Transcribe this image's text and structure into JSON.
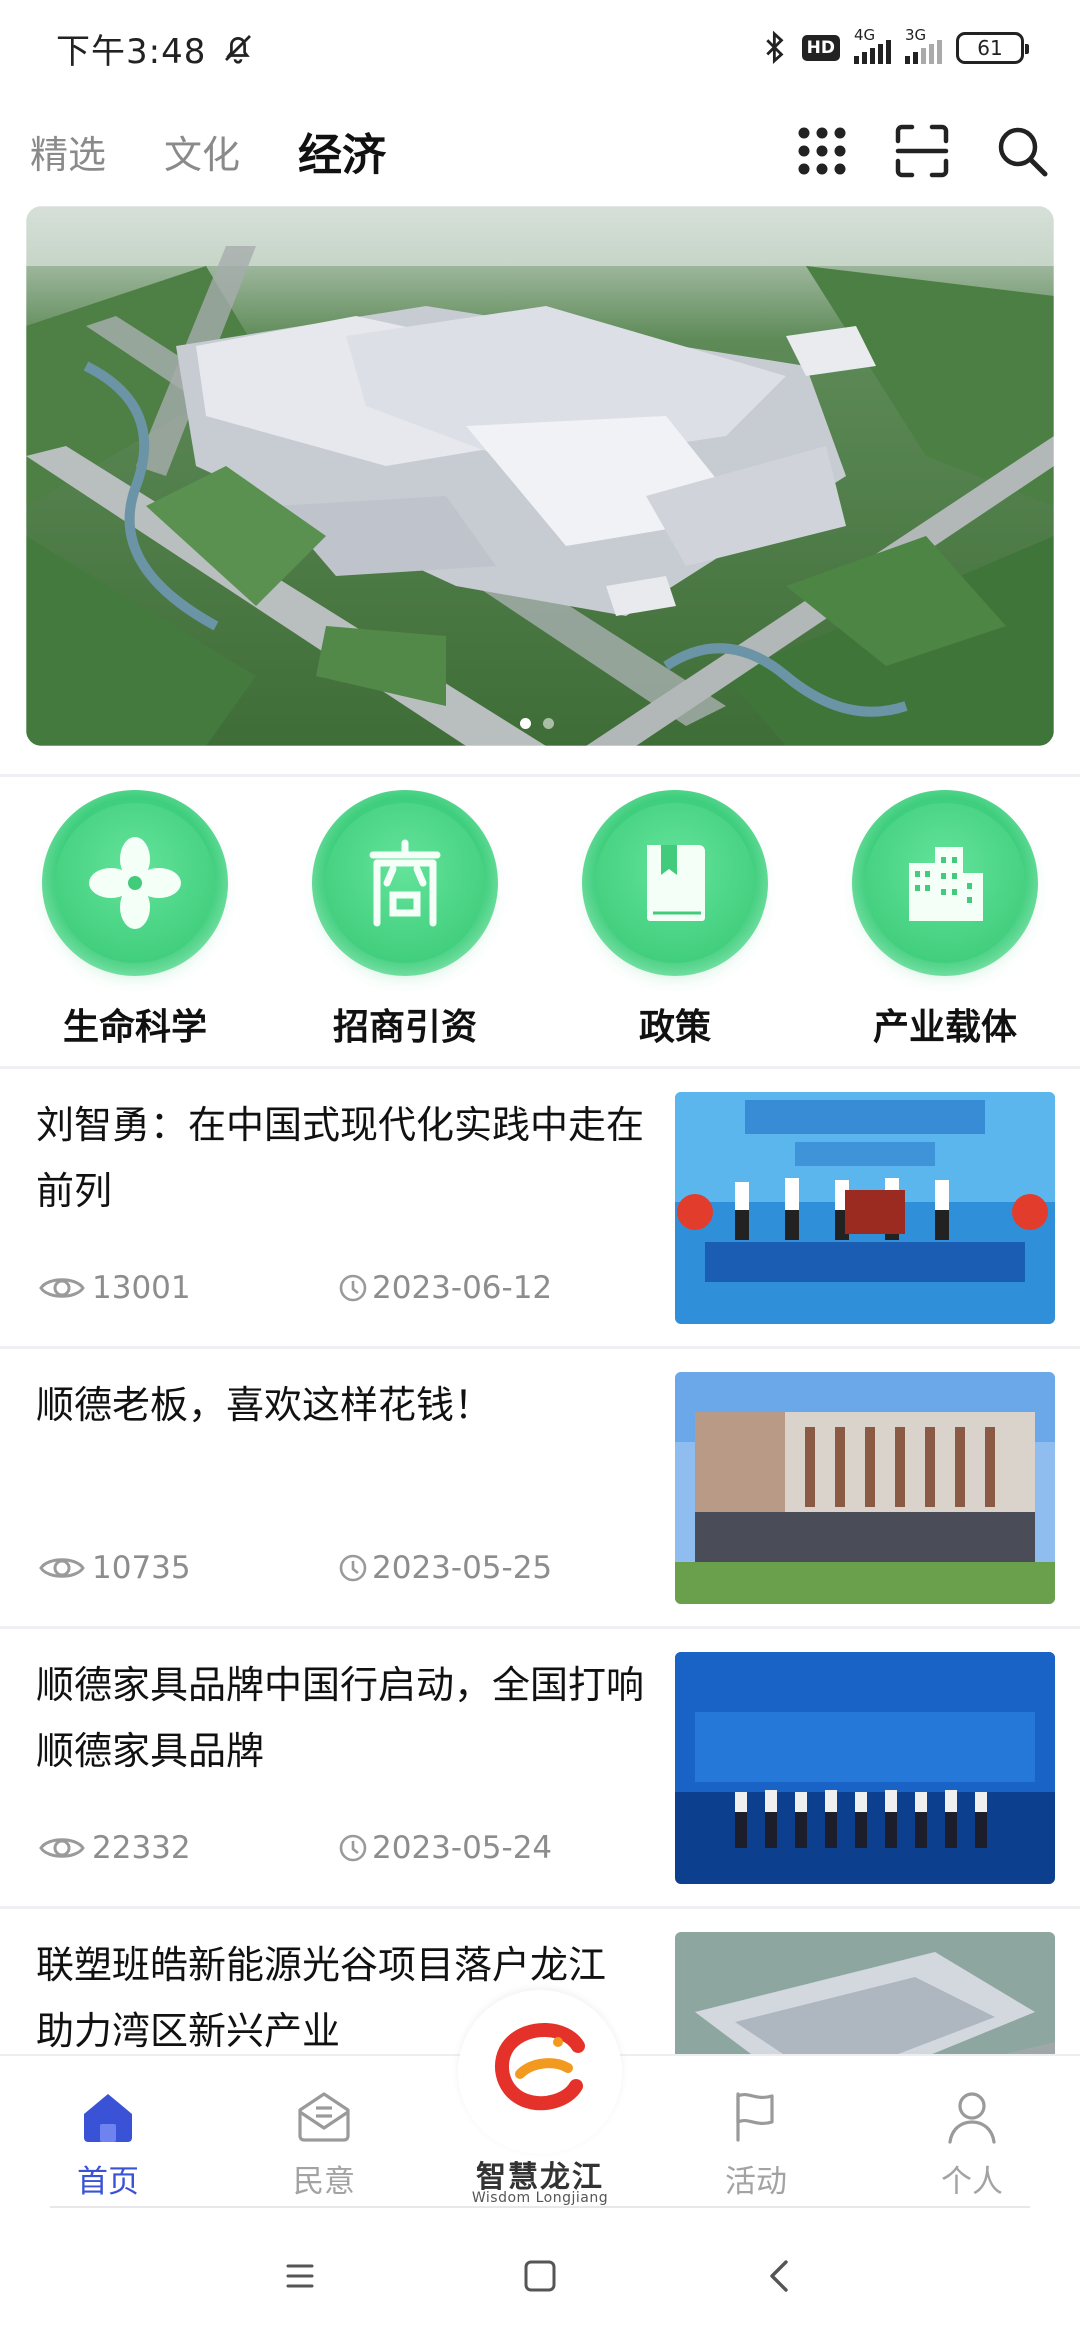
{
  "status_bar": {
    "time": "下午3:48",
    "hd": "HD",
    "network_1": "4G",
    "network_2": "3G",
    "battery": "61"
  },
  "top_tabs": [
    {
      "label": "精选",
      "active": false
    },
    {
      "label": "文化",
      "active": false
    },
    {
      "label": "经济",
      "active": true
    }
  ],
  "top_icons": [
    "apps-grid-icon",
    "scan-icon",
    "search-icon"
  ],
  "banner": {
    "slide_count": 2,
    "active_slide": 1
  },
  "categories": [
    {
      "label": "生命科学",
      "icon": "pinwheel-icon"
    },
    {
      "label": "招商引资",
      "icon": "shang-character-icon"
    },
    {
      "label": "政策",
      "icon": "book-icon"
    },
    {
      "label": "产业载体",
      "icon": "buildings-icon"
    }
  ],
  "news": [
    {
      "title": "刘智勇：在中国式现代化实践中走在前列",
      "views": "13001",
      "date": "2023-06-12"
    },
    {
      "title": "顺德老板，喜欢这样花钱！",
      "views": "10735",
      "date": "2023-05-25"
    },
    {
      "title": "顺德家具品牌中国行启动，全国打响顺德家具品牌",
      "views": "22332",
      "date": "2023-05-24"
    },
    {
      "title": "联塑班皓新能源光谷项目落户龙江 助力湾区新兴产业",
      "views": "",
      "date": ""
    }
  ],
  "bottom_nav": {
    "items": [
      {
        "label": "首页",
        "icon": "home-icon",
        "active": true
      },
      {
        "label": "民意",
        "icon": "mail-icon",
        "active": false
      },
      {
        "label": "活动",
        "icon": "flag-icon",
        "active": false
      },
      {
        "label": "个人",
        "icon": "person-icon",
        "active": false
      }
    ],
    "center_brand": "智慧龙江",
    "center_brand_sub": "Wisdom Longjiang"
  },
  "colors": {
    "accent_blue": "#3a52d6",
    "category_green": "#3fcf7e",
    "meta_gray": "#8d8d8d"
  }
}
